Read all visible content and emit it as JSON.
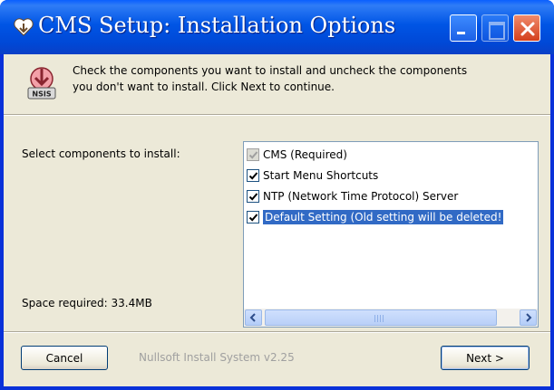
{
  "window": {
    "title": "CMS Setup: Installation Options",
    "title_bar_buttons": [
      "minimize",
      "maximize",
      "close"
    ]
  },
  "header": {
    "icon": "nsis-installer-icon",
    "icon_text": "NSIS",
    "description_line1": "Check the components you want to install and uncheck the components",
    "description_line2": "you don't want to install. Click Next to continue."
  },
  "components": {
    "label": "Select components to install:",
    "items": [
      {
        "label": "CMS (Required)",
        "checked": true,
        "disabled": true,
        "selected": false
      },
      {
        "label": "Start Menu Shortcuts",
        "checked": true,
        "disabled": false,
        "selected": false
      },
      {
        "label": "NTP (Network Time Protocol) Server",
        "checked": true,
        "disabled": false,
        "selected": false
      },
      {
        "label": "Default Setting (Old setting will be deleted!",
        "checked": true,
        "disabled": false,
        "selected": true
      }
    ]
  },
  "space_required": "Space required: 33.4MB",
  "footer": {
    "cancel_label": "Cancel",
    "branding": "Nullsoft Install System v2.25",
    "next_label": "Next >"
  },
  "colors": {
    "title_bar": "#0055e5",
    "dialog_face": "#ece9d8",
    "selection": "#316ac5"
  }
}
